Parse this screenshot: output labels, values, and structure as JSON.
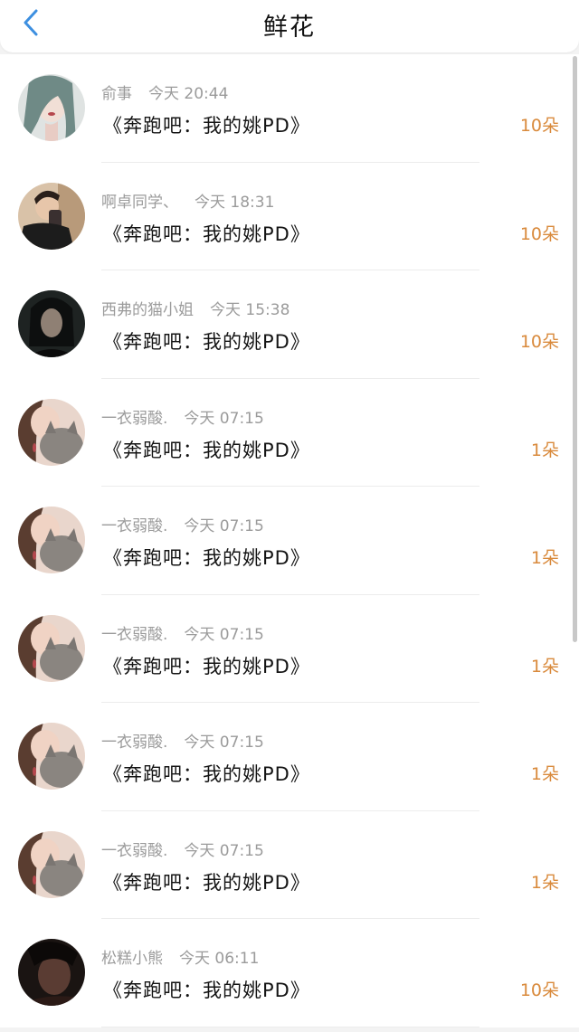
{
  "header": {
    "title": "鲜花"
  },
  "show_title": "《奔跑吧：我的姚PD》",
  "rows": [
    {
      "name": "俞事",
      "time": "今天 20:44",
      "amount": "10朵",
      "avatar_icon": "woman-portrait-avatar"
    },
    {
      "name": "啊卓同学、",
      "time": "今天 18:31",
      "amount": "10朵",
      "avatar_icon": "mirror-selfie-avatar"
    },
    {
      "name": "西弗的猫小姐",
      "time": "今天 15:38",
      "amount": "10朵",
      "avatar_icon": "dark-hair-man-avatar"
    },
    {
      "name": "一衣弱酸.",
      "time": "今天 07:15",
      "amount": "1朵",
      "avatar_icon": "girl-with-cat-avatar"
    },
    {
      "name": "一衣弱酸.",
      "time": "今天 07:15",
      "amount": "1朵",
      "avatar_icon": "girl-with-cat-avatar"
    },
    {
      "name": "一衣弱酸.",
      "time": "今天 07:15",
      "amount": "1朵",
      "avatar_icon": "girl-with-cat-avatar"
    },
    {
      "name": "一衣弱酸.",
      "time": "今天 07:15",
      "amount": "1朵",
      "avatar_icon": "girl-with-cat-avatar"
    },
    {
      "name": "一衣弱酸.",
      "time": "今天 07:15",
      "amount": "1朵",
      "avatar_icon": "girl-with-cat-avatar"
    },
    {
      "name": "松糕小熊",
      "time": "今天 06:11",
      "amount": "10朵",
      "avatar_icon": "dark-portrait-avatar"
    }
  ],
  "colors": {
    "accent_back": "#3d8fe0",
    "amount_orange": "#d98a3c",
    "meta_gray": "#9b9b9b"
  }
}
